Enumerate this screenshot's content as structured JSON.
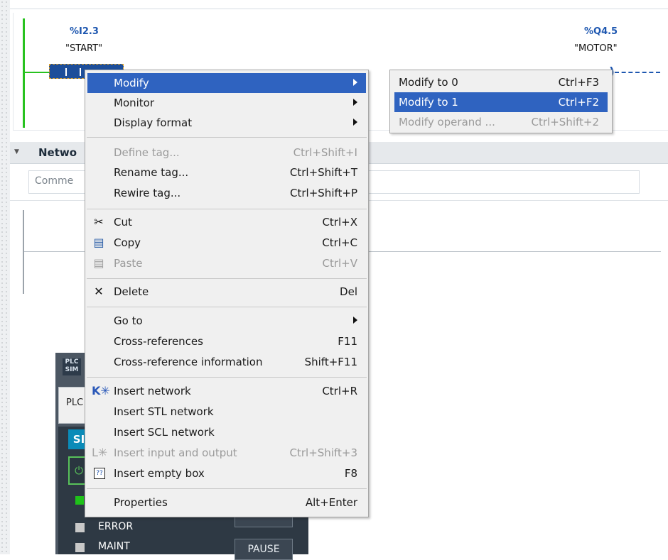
{
  "network1": {
    "contact": {
      "address": "%I2.3",
      "name": "\"START\""
    },
    "coil": {
      "address": "%Q4.5",
      "name": "\"MOTOR\""
    }
  },
  "network2": {
    "title": "Netwo",
    "comment_placeholder": "Comme"
  },
  "plcsim": {
    "logo": "PLC SIM",
    "tab_label": "PLC",
    "brand_fragment": "SI",
    "power_icon": "power-icon",
    "leds": [
      {
        "label": "ERROR",
        "color": "#c8c8c8"
      },
      {
        "label": "MAINT",
        "color": "#c8c8c8"
      }
    ],
    "run_led_color": "#1fc21a",
    "pause_button": "PAUSE"
  },
  "context_menu": {
    "items": [
      {
        "id": "modify",
        "label": "Modify",
        "submenu": true,
        "selected": true
      },
      {
        "id": "monitor",
        "label": "Monitor",
        "submenu": true
      },
      {
        "id": "display-format",
        "label": "Display format",
        "submenu": true
      },
      {
        "id": "define-tag",
        "label": "Define tag...",
        "shortcut": "Ctrl+Shift+I",
        "disabled": true
      },
      {
        "id": "rename-tag",
        "label": "Rename tag...",
        "shortcut": "Ctrl+Shift+T"
      },
      {
        "id": "rewire-tag",
        "label": "Rewire tag...",
        "shortcut": "Ctrl+Shift+P"
      },
      {
        "id": "cut",
        "label": "Cut",
        "shortcut": "Ctrl+X",
        "icon": "scissors-icon"
      },
      {
        "id": "copy",
        "label": "Copy",
        "shortcut": "Ctrl+C",
        "icon": "copy-icon"
      },
      {
        "id": "paste",
        "label": "Paste",
        "shortcut": "Ctrl+V",
        "icon": "paste-icon",
        "disabled": true
      },
      {
        "id": "delete",
        "label": "Delete",
        "shortcut": "Del",
        "icon": "delete-x-icon"
      },
      {
        "id": "go-to",
        "label": "Go to",
        "submenu": true
      },
      {
        "id": "cross-references",
        "label": "Cross-references",
        "shortcut": "F11"
      },
      {
        "id": "cross-reference-information",
        "label": "Cross-reference information",
        "shortcut": "Shift+F11"
      },
      {
        "id": "insert-network",
        "label": "Insert network",
        "shortcut": "Ctrl+R",
        "icon": "insert-network-icon"
      },
      {
        "id": "insert-stl-network",
        "label": "Insert STL network"
      },
      {
        "id": "insert-scl-network",
        "label": "Insert SCL network"
      },
      {
        "id": "insert-input-and-output",
        "label": "Insert input and output",
        "shortcut": "Ctrl+Shift+3",
        "icon": "insert-io-icon",
        "disabled": true
      },
      {
        "id": "insert-empty-box",
        "label": "Insert empty box",
        "shortcut": "F8",
        "icon": "empty-box-icon"
      },
      {
        "id": "properties",
        "label": "Properties",
        "shortcut": "Alt+Enter"
      }
    ]
  },
  "submenu": {
    "items": [
      {
        "id": "modify-to-0",
        "label": "Modify to 0",
        "shortcut": "Ctrl+F3"
      },
      {
        "id": "modify-to-1",
        "label": "Modify to 1",
        "shortcut": "Ctrl+F2",
        "selected": true
      },
      {
        "id": "modify-operand",
        "label": "Modify operand ...",
        "shortcut": "Ctrl+Shift+2",
        "disabled": true
      }
    ]
  },
  "colors": {
    "selection": "#2f63c0",
    "power_rail_active": "#28c21f",
    "tag_address": "#1e57b0"
  }
}
